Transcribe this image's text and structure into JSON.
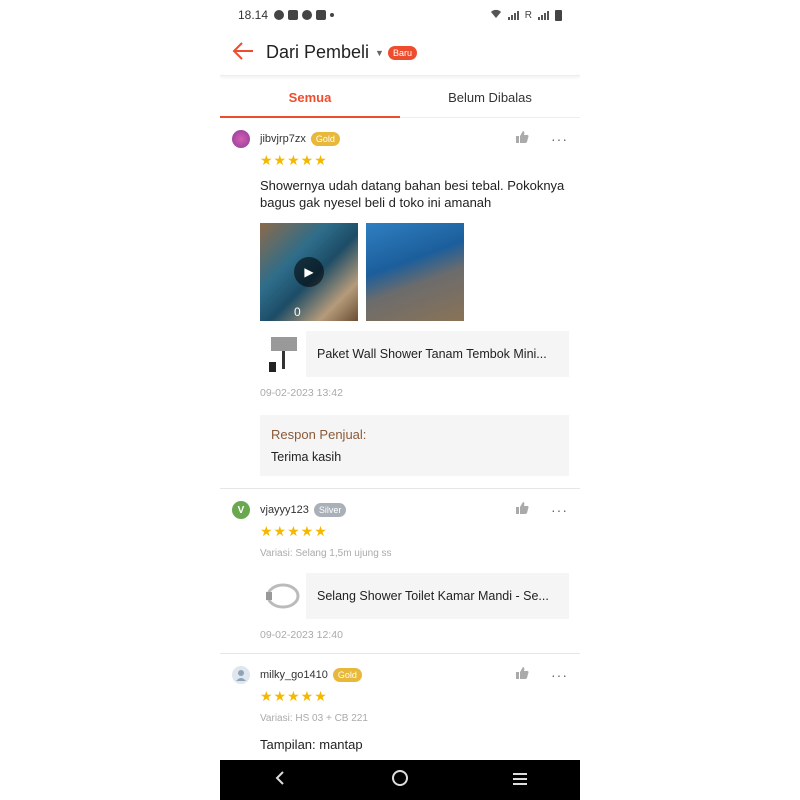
{
  "status_bar": {
    "time": "18.14",
    "network_label": "R"
  },
  "header": {
    "title": "Dari Pembeli",
    "badge": "Baru"
  },
  "tabs": [
    {
      "label": "Semua",
      "active": true
    },
    {
      "label": "Belum Dibalas",
      "active": false
    }
  ],
  "reviews": [
    {
      "username": "jibvjrp7zx",
      "tier": "Gold",
      "stars": "★★★★★",
      "comment": "Showernya udah datang bahan besi tebal. Pokoknya bagus gak nyesel beli d toko ini amanah",
      "video_duration": "0",
      "product_name": "Paket Wall Shower Tanam Tembok Mini...",
      "timestamp": "09-02-2023 13:42",
      "response_label": "Respon Penjual:",
      "response_text": "Terima kasih"
    },
    {
      "username": "vjayyy123",
      "avatar_letter": "V",
      "tier": "Silver",
      "stars": "★★★★★",
      "variation": "Variasi: Selang 1,5m ujung ss",
      "product_name": "Selang Shower Toilet Kamar Mandi  - Se...",
      "timestamp": "09-02-2023 12:40"
    },
    {
      "username": "milky_go1410",
      "tier": "Gold",
      "stars": "★★★★★",
      "variation": "Variasi: HS 03 + CB 221",
      "comment": "Tampilan: mantap"
    }
  ],
  "colors": {
    "accent": "#ee4d2d",
    "star": "#f5b800",
    "gold_tier": "#e8b83a",
    "silver_tier": "#a9b0b8"
  },
  "icons": [
    "back-arrow-icon",
    "thumb-up-icon",
    "more-icon",
    "play-icon",
    "nav-back-icon",
    "nav-home-icon",
    "nav-recents-icon"
  ]
}
